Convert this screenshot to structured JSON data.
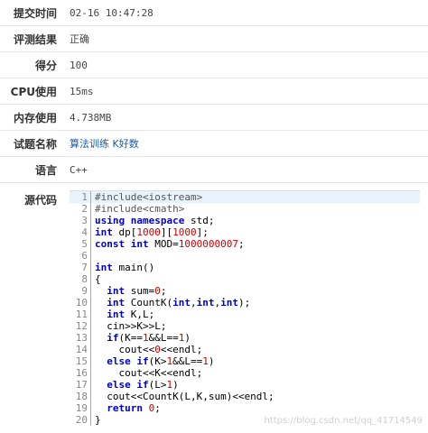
{
  "rows": [
    {
      "label": "提交时间",
      "value": "02-16 10:47:28"
    },
    {
      "label": "评测结果",
      "value": "正确"
    },
    {
      "label": "得分",
      "value": "100"
    },
    {
      "label": "CPU使用",
      "value": "15ms"
    },
    {
      "label": "内存使用",
      "value": "4.738MB"
    },
    {
      "label": "试题名称",
      "value": "算法训练 K好数"
    },
    {
      "label": "语言",
      "value": "C++"
    }
  ],
  "code_label": "源代码",
  "code_lines": [
    {
      "n": "1",
      "parts": [
        {
          "t": "#include<iostream>",
          "c": "pp"
        }
      ]
    },
    {
      "n": "2",
      "parts": [
        {
          "t": "#include<cmath>",
          "c": "pp"
        }
      ]
    },
    {
      "n": "3",
      "parts": [
        {
          "t": "using namespace",
          "c": "kw"
        },
        {
          "t": " std;",
          "c": ""
        }
      ]
    },
    {
      "n": "4",
      "parts": [
        {
          "t": "int",
          "c": "kw"
        },
        {
          "t": " dp[",
          "c": ""
        },
        {
          "t": "1000",
          "c": "num"
        },
        {
          "t": "][",
          "c": ""
        },
        {
          "t": "1000",
          "c": "num"
        },
        {
          "t": "];",
          "c": ""
        }
      ]
    },
    {
      "n": "5",
      "parts": [
        {
          "t": "const int",
          "c": "kw"
        },
        {
          "t": " MOD=",
          "c": ""
        },
        {
          "t": "1000000007",
          "c": "num"
        },
        {
          "t": ";",
          "c": ""
        }
      ]
    },
    {
      "n": "6",
      "parts": [
        {
          "t": "",
          "c": ""
        }
      ]
    },
    {
      "n": "7",
      "parts": [
        {
          "t": "int",
          "c": "kw"
        },
        {
          "t": " main()",
          "c": ""
        }
      ]
    },
    {
      "n": "8",
      "parts": [
        {
          "t": "{",
          "c": ""
        }
      ]
    },
    {
      "n": "9",
      "parts": [
        {
          "t": "  ",
          "c": ""
        },
        {
          "t": "int",
          "c": "kw"
        },
        {
          "t": " sum=",
          "c": ""
        },
        {
          "t": "0",
          "c": "num"
        },
        {
          "t": ";",
          "c": ""
        }
      ]
    },
    {
      "n": "10",
      "parts": [
        {
          "t": "  ",
          "c": ""
        },
        {
          "t": "int",
          "c": "kw"
        },
        {
          "t": " CountK(",
          "c": ""
        },
        {
          "t": "int",
          "c": "kw"
        },
        {
          "t": ",",
          "c": ""
        },
        {
          "t": "int",
          "c": "kw"
        },
        {
          "t": ",",
          "c": ""
        },
        {
          "t": "int",
          "c": "kw"
        },
        {
          "t": ");",
          "c": ""
        }
      ]
    },
    {
      "n": "11",
      "parts": [
        {
          "t": "  ",
          "c": ""
        },
        {
          "t": "int",
          "c": "kw"
        },
        {
          "t": " K,L;",
          "c": ""
        }
      ]
    },
    {
      "n": "12",
      "parts": [
        {
          "t": "  cin>>K>>L;",
          "c": ""
        }
      ]
    },
    {
      "n": "13",
      "parts": [
        {
          "t": "  ",
          "c": ""
        },
        {
          "t": "if",
          "c": "kw"
        },
        {
          "t": "(K==",
          "c": ""
        },
        {
          "t": "1",
          "c": "num"
        },
        {
          "t": "&&L==",
          "c": ""
        },
        {
          "t": "1",
          "c": "num"
        },
        {
          "t": ")",
          "c": ""
        }
      ]
    },
    {
      "n": "14",
      "parts": [
        {
          "t": "    cout<<",
          "c": ""
        },
        {
          "t": "0",
          "c": "num"
        },
        {
          "t": "<<endl;",
          "c": ""
        }
      ]
    },
    {
      "n": "15",
      "parts": [
        {
          "t": "  ",
          "c": ""
        },
        {
          "t": "else if",
          "c": "kw"
        },
        {
          "t": "(K>",
          "c": ""
        },
        {
          "t": "1",
          "c": "num"
        },
        {
          "t": "&&L==",
          "c": ""
        },
        {
          "t": "1",
          "c": "num"
        },
        {
          "t": ")",
          "c": ""
        }
      ]
    },
    {
      "n": "16",
      "parts": [
        {
          "t": "    cout<<K<<endl;",
          "c": ""
        }
      ]
    },
    {
      "n": "17",
      "parts": [
        {
          "t": "  ",
          "c": ""
        },
        {
          "t": "else if",
          "c": "kw"
        },
        {
          "t": "(L>",
          "c": ""
        },
        {
          "t": "1",
          "c": "num"
        },
        {
          "t": ")",
          "c": ""
        }
      ]
    },
    {
      "n": "18",
      "parts": [
        {
          "t": "  cout<<CountK(L,K,sum)<<endl;",
          "c": ""
        }
      ]
    },
    {
      "n": "19",
      "parts": [
        {
          "t": "  ",
          "c": ""
        },
        {
          "t": "return",
          "c": "kw"
        },
        {
          "t": " ",
          "c": ""
        },
        {
          "t": "0",
          "c": "num"
        },
        {
          "t": ";",
          "c": ""
        }
      ]
    },
    {
      "n": "20",
      "parts": [
        {
          "t": "}",
          "c": ""
        }
      ]
    }
  ],
  "watermark": "https://blog.csdn.net/qq_41714549"
}
